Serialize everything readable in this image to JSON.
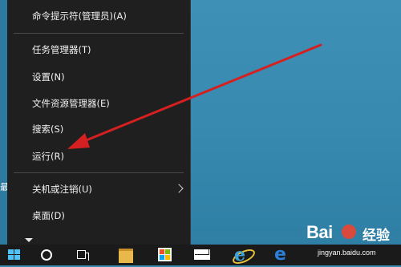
{
  "menu": {
    "items": [
      {
        "label": "命令提示符(管理员)(A)",
        "has_submenu": false
      },
      {
        "label": "任务管理器(T)",
        "has_submenu": false
      },
      {
        "label": "设置(N)",
        "has_submenu": false
      },
      {
        "label": "文件资源管理器(E)",
        "has_submenu": false
      },
      {
        "label": "搜索(S)",
        "has_submenu": false
      },
      {
        "label": "运行(R)",
        "has_submenu": false
      },
      {
        "label": "关机或注销(U)",
        "has_submenu": true
      },
      {
        "label": "桌面(D)",
        "has_submenu": false
      }
    ]
  },
  "desktop": {
    "partial_char": "最"
  },
  "taskbar": {
    "icons": [
      "windows-start-icon",
      "cortana-circle-icon",
      "task-view-icon",
      "file-explorer-icon",
      "store-icon",
      "mail-icon",
      "internet-explorer-icon",
      "edge-icon"
    ]
  },
  "watermark": {
    "brand": "Bai",
    "product": "经验",
    "url": "jingyan.baidu.com"
  },
  "colors": {
    "menu_bg": "#1f1f1f",
    "desktop": "#3b8cb2",
    "arrow": "#d42020",
    "taskbar": "#1a1a1a"
  }
}
